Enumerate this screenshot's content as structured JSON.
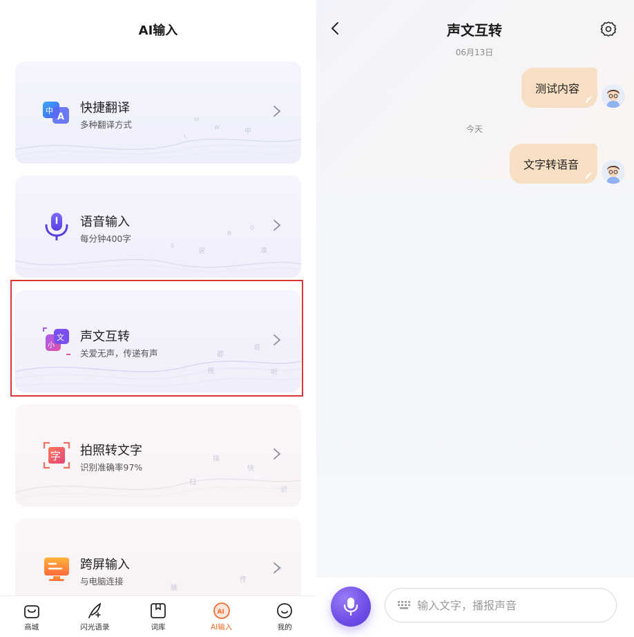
{
  "left": {
    "title": "AI输入",
    "cards": [
      {
        "title": "快捷翻译",
        "subtitle": "多种翻译方式",
        "icon": "translate-icon",
        "deco": [
          "ㅂ",
          "w",
          "中",
          "ㄴ"
        ]
      },
      {
        "title": "语音输入",
        "subtitle": "每分钟400字",
        "icon": "microphone-icon",
        "deco": [
          "s",
          "说",
          "准",
          "a",
          "o"
        ]
      },
      {
        "title": "声文互转",
        "subtitle": "关爱无声，传递有声",
        "icon": "voice-text-convert-icon",
        "deco": [
          "都",
          "视",
          "听",
          "说"
        ]
      },
      {
        "title": "拍照转文字",
        "subtitle": "识别准确率97%",
        "icon": "photo-text-icon",
        "deco": [
          "扫",
          "识",
          "快",
          "描"
        ]
      },
      {
        "title": "跨屏输入",
        "subtitle": "与电脑连接",
        "icon": "monitor-icon",
        "deco": [
          "传",
          "输",
          "e"
        ]
      }
    ]
  },
  "nav": [
    {
      "label": "商城",
      "icon": "shop-bag-icon",
      "active": false
    },
    {
      "label": "闪光语录",
      "icon": "feather-pen-icon",
      "active": false
    },
    {
      "label": "词库",
      "icon": "book-icon",
      "active": false
    },
    {
      "label": "AI输入",
      "icon": "ai-input-icon",
      "active": true
    },
    {
      "label": "我的",
      "icon": "smiley-icon",
      "active": false
    }
  ],
  "right": {
    "title": "声文互转",
    "messages": [
      {
        "date": "06月13日",
        "text": "测试内容"
      },
      {
        "date": "今天",
        "text": "文字转语音"
      }
    ],
    "input": {
      "placeholder": "输入文字，播报声音"
    }
  },
  "colors": {
    "accent": "#f26b2a",
    "bubble": "#f7dfc4",
    "highlight": "#d83636",
    "mic": "#6d4de6"
  }
}
